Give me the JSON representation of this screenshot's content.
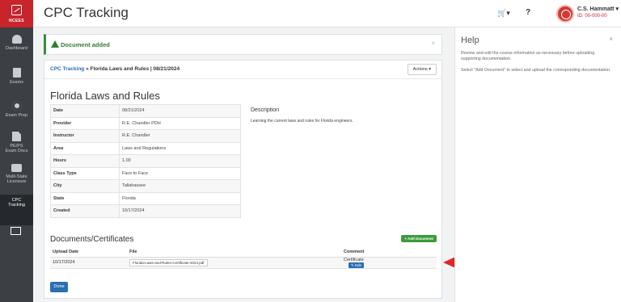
{
  "sidebar": {
    "logo": "NCEES",
    "items": [
      {
        "label": "Dashboard",
        "icon": "dashboard-icon"
      },
      {
        "label": "Exams",
        "icon": "book-icon"
      },
      {
        "label": "Exam Prep",
        "icon": "gears-icon"
      },
      {
        "label": "PE/PS",
        "label2": "Exam Docs",
        "icon": "documents-icon"
      },
      {
        "label": "Multi-State",
        "label2": "Licensure",
        "icon": "briefcase-icon"
      },
      {
        "label": "CPC",
        "label2": "Tracking",
        "icon": "cpc-card-icon",
        "active": true
      }
    ]
  },
  "header": {
    "title": "CPC Tracking",
    "help": "?",
    "user_name": "C.S. Hammatt",
    "user_id": "ID: 00-000-00"
  },
  "alert": {
    "message": "Document added",
    "close": "×"
  },
  "breadcrumb": {
    "link": "CPC Tracking",
    "current": " » Florida Laws and Rules | 08/21/2024"
  },
  "actions_label": "Actions ▾",
  "course": {
    "title": "Florida Laws and Rules",
    "details": [
      {
        "key": "Date",
        "value": "08/21/2024"
      },
      {
        "key": "Provider",
        "value": "R.E. Chandler PDH"
      },
      {
        "key": "Instructor",
        "value": "R.E. Chandler"
      },
      {
        "key": "Area",
        "value": "Laws and Regulations"
      },
      {
        "key": "Hours",
        "value": "1.00"
      },
      {
        "key": "Class Type",
        "value": "Face to Face"
      },
      {
        "key": "City",
        "value": "Tallahassee"
      },
      {
        "key": "State",
        "value": "Florida"
      },
      {
        "key": "Created",
        "value": "10/17/2024"
      }
    ],
    "description_heading": "Description",
    "description": "Learning the current laws and rules for Florida engineers."
  },
  "documents": {
    "heading": "Documents/Certificates",
    "add_label": "+ Add Document",
    "columns": [
      "Upload Date",
      "File",
      "Comment"
    ],
    "rows": [
      {
        "upload_date": "10/17/2024",
        "file": "Florida-Laws-and-Rules-Certificate-2024.pdf",
        "comment": "Certificate",
        "edit": "Edit"
      }
    ]
  },
  "done_label": "Done",
  "help_panel": {
    "title": "Help",
    "close": "×",
    "p1": "Review and edit the course information as necessary before uploading supporting documentation.",
    "p2": "Select \"Add Document\" to select and upload the corresponding documentation."
  },
  "colors": {
    "brand": "#c8242c",
    "success": "#3b9a3b",
    "link": "#2a6fb0",
    "arrow": "#e3262b"
  }
}
